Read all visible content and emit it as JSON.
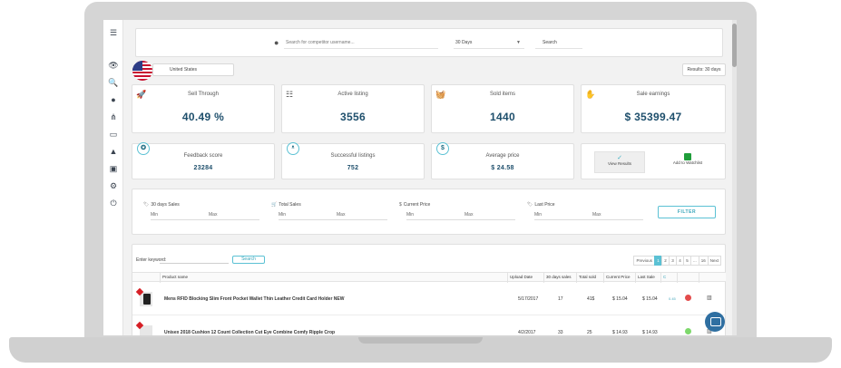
{
  "search": {
    "placeholder": "Search for competitor username...",
    "period": "30 Days",
    "button": "Search"
  },
  "country": "United States",
  "results_label": "Results: 30 days",
  "stats": [
    {
      "label": "Sell Through",
      "value": "40.49 %",
      "icon": "rocket-icon"
    },
    {
      "label": "Active listing",
      "value": "3556",
      "icon": "list-icon"
    },
    {
      "label": "Sold items",
      "value": "1440",
      "icon": "basket-icon"
    },
    {
      "label": "Sale earnings",
      "value": "$ 35399.47",
      "icon": "hand-money-icon"
    }
  ],
  "stats2": [
    {
      "label": "Feedback score",
      "value": "23284",
      "icon": "ribbon-badge-icon"
    },
    {
      "label": "Successful listings",
      "value": "752",
      "icon": "medal-icon"
    },
    {
      "label": "Average price",
      "value": "$ 24.58",
      "icon": "dollar-icon",
      "badge": "$"
    }
  ],
  "actions": {
    "view_results": "View Results",
    "add_watchlist": "Add to Watchlist"
  },
  "filters": [
    {
      "title": "30 days Sales",
      "min": "Min",
      "max": "Max"
    },
    {
      "title": "Total Sales",
      "min": "Min",
      "max": "Max"
    },
    {
      "title": "Current Price",
      "min": "Min",
      "max": "Max"
    },
    {
      "title": "Last Price",
      "min": "Min",
      "max": "Max"
    }
  ],
  "filter_button": "FILTER",
  "table": {
    "keyword_label": "Enter keyword:",
    "search_button": "Search",
    "pager": [
      "Previous",
      "1",
      "2",
      "3",
      "4",
      "5",
      "...",
      "16",
      "Next"
    ],
    "columns": [
      "Product name",
      "Upload Date",
      "30 days sales",
      "Total sold",
      "Current Price",
      "Last Sale",
      "C"
    ],
    "rows": [
      {
        "name": "Mens RFID Blocking Slim Front Pocket Wallet Thin Leather Credit Card Holder NEW",
        "upload": "5/17/2017",
        "sales30": "17",
        "total": "41$",
        "current": "$ 15.04",
        "last": "$ 15.04",
        "c": "0.45",
        "status": "red"
      },
      {
        "name": "Unisex 2018 Cushion 12 Count Collection Cut Eye Combine Comfy Ripple Crop",
        "upload": "4/2/2017",
        "sales30": "33",
        "total": "25",
        "current": "$ 14.93",
        "last": "$ 14.93",
        "c": "",
        "status": "green"
      }
    ]
  },
  "colors": {
    "accent": "#5bc1d4",
    "value_text": "#1e4f6c",
    "status_red": "#e34b4b",
    "status_green": "#7dd86b",
    "chat": "#2f6fa1"
  }
}
